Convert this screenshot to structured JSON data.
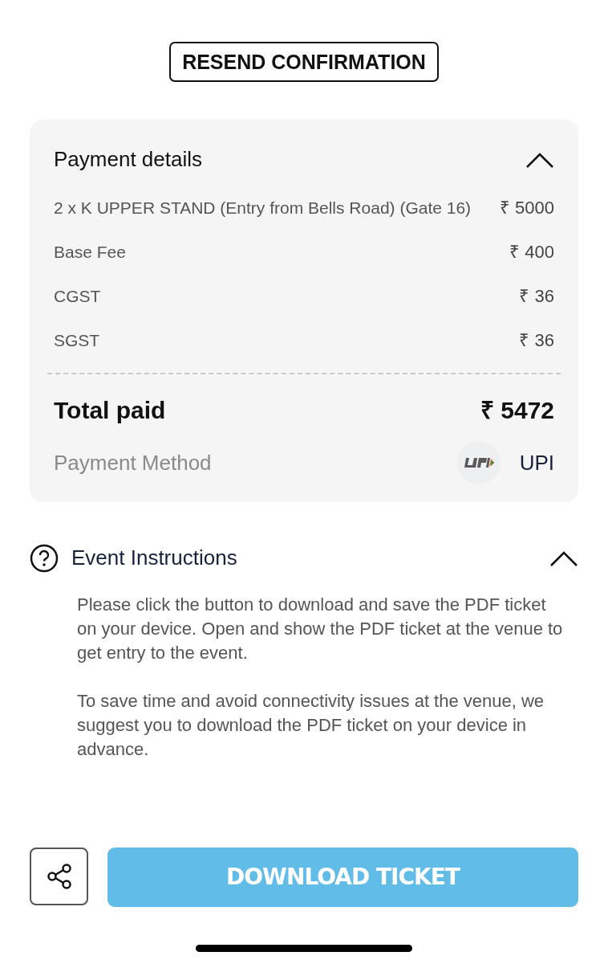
{
  "resend_button": "RESEND CONFIRMATION",
  "payment_details": {
    "title": "Payment details",
    "expanded": true,
    "items": [
      {
        "label": "2 x K UPPER STAND (Entry from Bells Road) (Gate 16)",
        "amount": "₹ 5000"
      },
      {
        "label": "Base Fee",
        "amount": "₹ 400"
      },
      {
        "label": "CGST",
        "amount": "₹ 36"
      },
      {
        "label": "SGST",
        "amount": "₹ 36"
      }
    ],
    "total_label": "Total paid",
    "total_amount": "₹ 5472",
    "method_label": "Payment Method",
    "method_value": "UPI"
  },
  "event_instructions": {
    "title": "Event Instructions",
    "expanded": true,
    "paragraphs": [
      "Please click the button to download and save the PDF ticket on your device. Open and show the PDF ticket at the venue to get entry to the event.",
      "To save time and avoid connectivity issues at the venue, we suggest you to download the PDF ticket on your device in advance."
    ]
  },
  "download_button": "DOWNLOAD TICKET"
}
